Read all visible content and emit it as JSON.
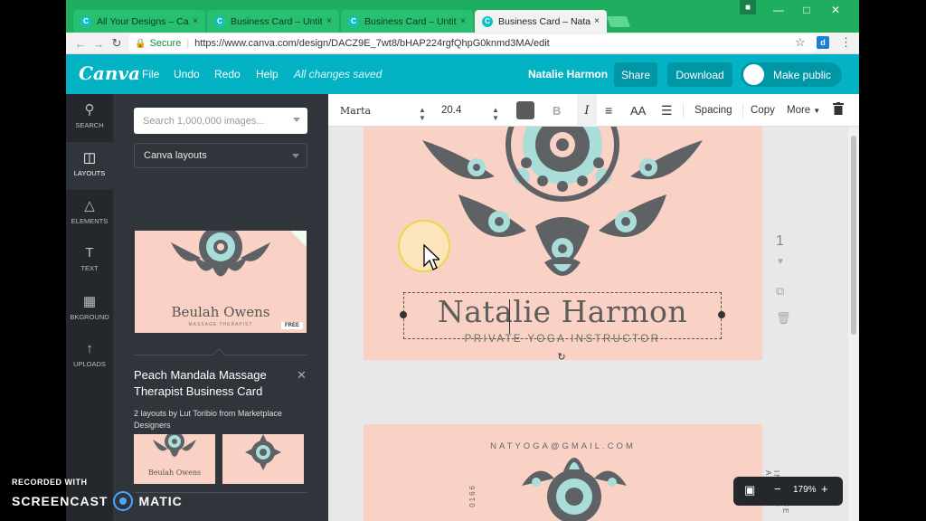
{
  "browser": {
    "tabs": [
      {
        "label": "All Your Designs – Canva",
        "active": false
      },
      {
        "label": "Business Card – Untitled",
        "active": false
      },
      {
        "label": "Business Card – Untitled",
        "active": false
      },
      {
        "label": "Business Card – Natalie H",
        "active": true
      }
    ],
    "tab_close": "×",
    "favicon_letter": "C",
    "url_secure": "Secure",
    "url": "https://www.canva.com/design/DACZ9E_7wt8/bHAP224rgfQhpG0knmd3MA/edit",
    "ext_letter": "d"
  },
  "header": {
    "logo": "Canva",
    "menu": [
      "File",
      "Undo",
      "Redo",
      "Help"
    ],
    "status": "All changes saved",
    "user": "Natalie Harmon",
    "share": "Share",
    "download": "Download",
    "make_public": "Make public"
  },
  "sidenav": [
    {
      "label": "SEARCH",
      "icon": "search-icon"
    },
    {
      "label": "LAYOUTS",
      "icon": "layouts-icon"
    },
    {
      "label": "ELEMENTS",
      "icon": "elements-icon"
    },
    {
      "label": "TEXT",
      "icon": "text-icon"
    },
    {
      "label": "BKGROUND",
      "icon": "background-icon"
    },
    {
      "label": "UPLOADS",
      "icon": "upload-icon"
    }
  ],
  "panel": {
    "search_placeholder": "Search 1,000,000 images...",
    "layout_select": "Canva layouts",
    "thumb_name": "Beulah Owens",
    "thumb_sub": "MASSAGE THERAPIST",
    "free_badge": "FREE",
    "title": "Peach Mandala Massage Therapist Business Card",
    "desc": "2 layouts by Lut Toribio from Marketplace Designers",
    "mini1_name": "Beulah Owens"
  },
  "toolbar": {
    "font": "Marta",
    "size": "20.4",
    "bold": "B",
    "italic": "I",
    "case": "AA",
    "spacing": "Spacing",
    "copy": "Copy",
    "more": "More"
  },
  "canvas": {
    "name": "Natalie Harmon",
    "subtitle": "PRIVATE YOGA INSTRUCTOR",
    "page_number": "1",
    "email": "NATYOGA@GMAIL.COM",
    "vertical_left": "0166",
    "vertical_right1": "INSTRU AUS",
    "vertical_right2": "OFFE"
  },
  "zoom": {
    "minus": "−",
    "value": "179%",
    "plus": "+"
  },
  "watermark": {
    "line1": "RECORDED WITH",
    "line2a": "SCREENCAST",
    "line2b": "MATIC"
  },
  "colors": {
    "brand": "#03b2c3",
    "tab_bar": "#1fae5f",
    "card_bg": "#f9d2c5",
    "mandala_dark": "#5f6264",
    "mandala_teal": "#a9ddda"
  }
}
